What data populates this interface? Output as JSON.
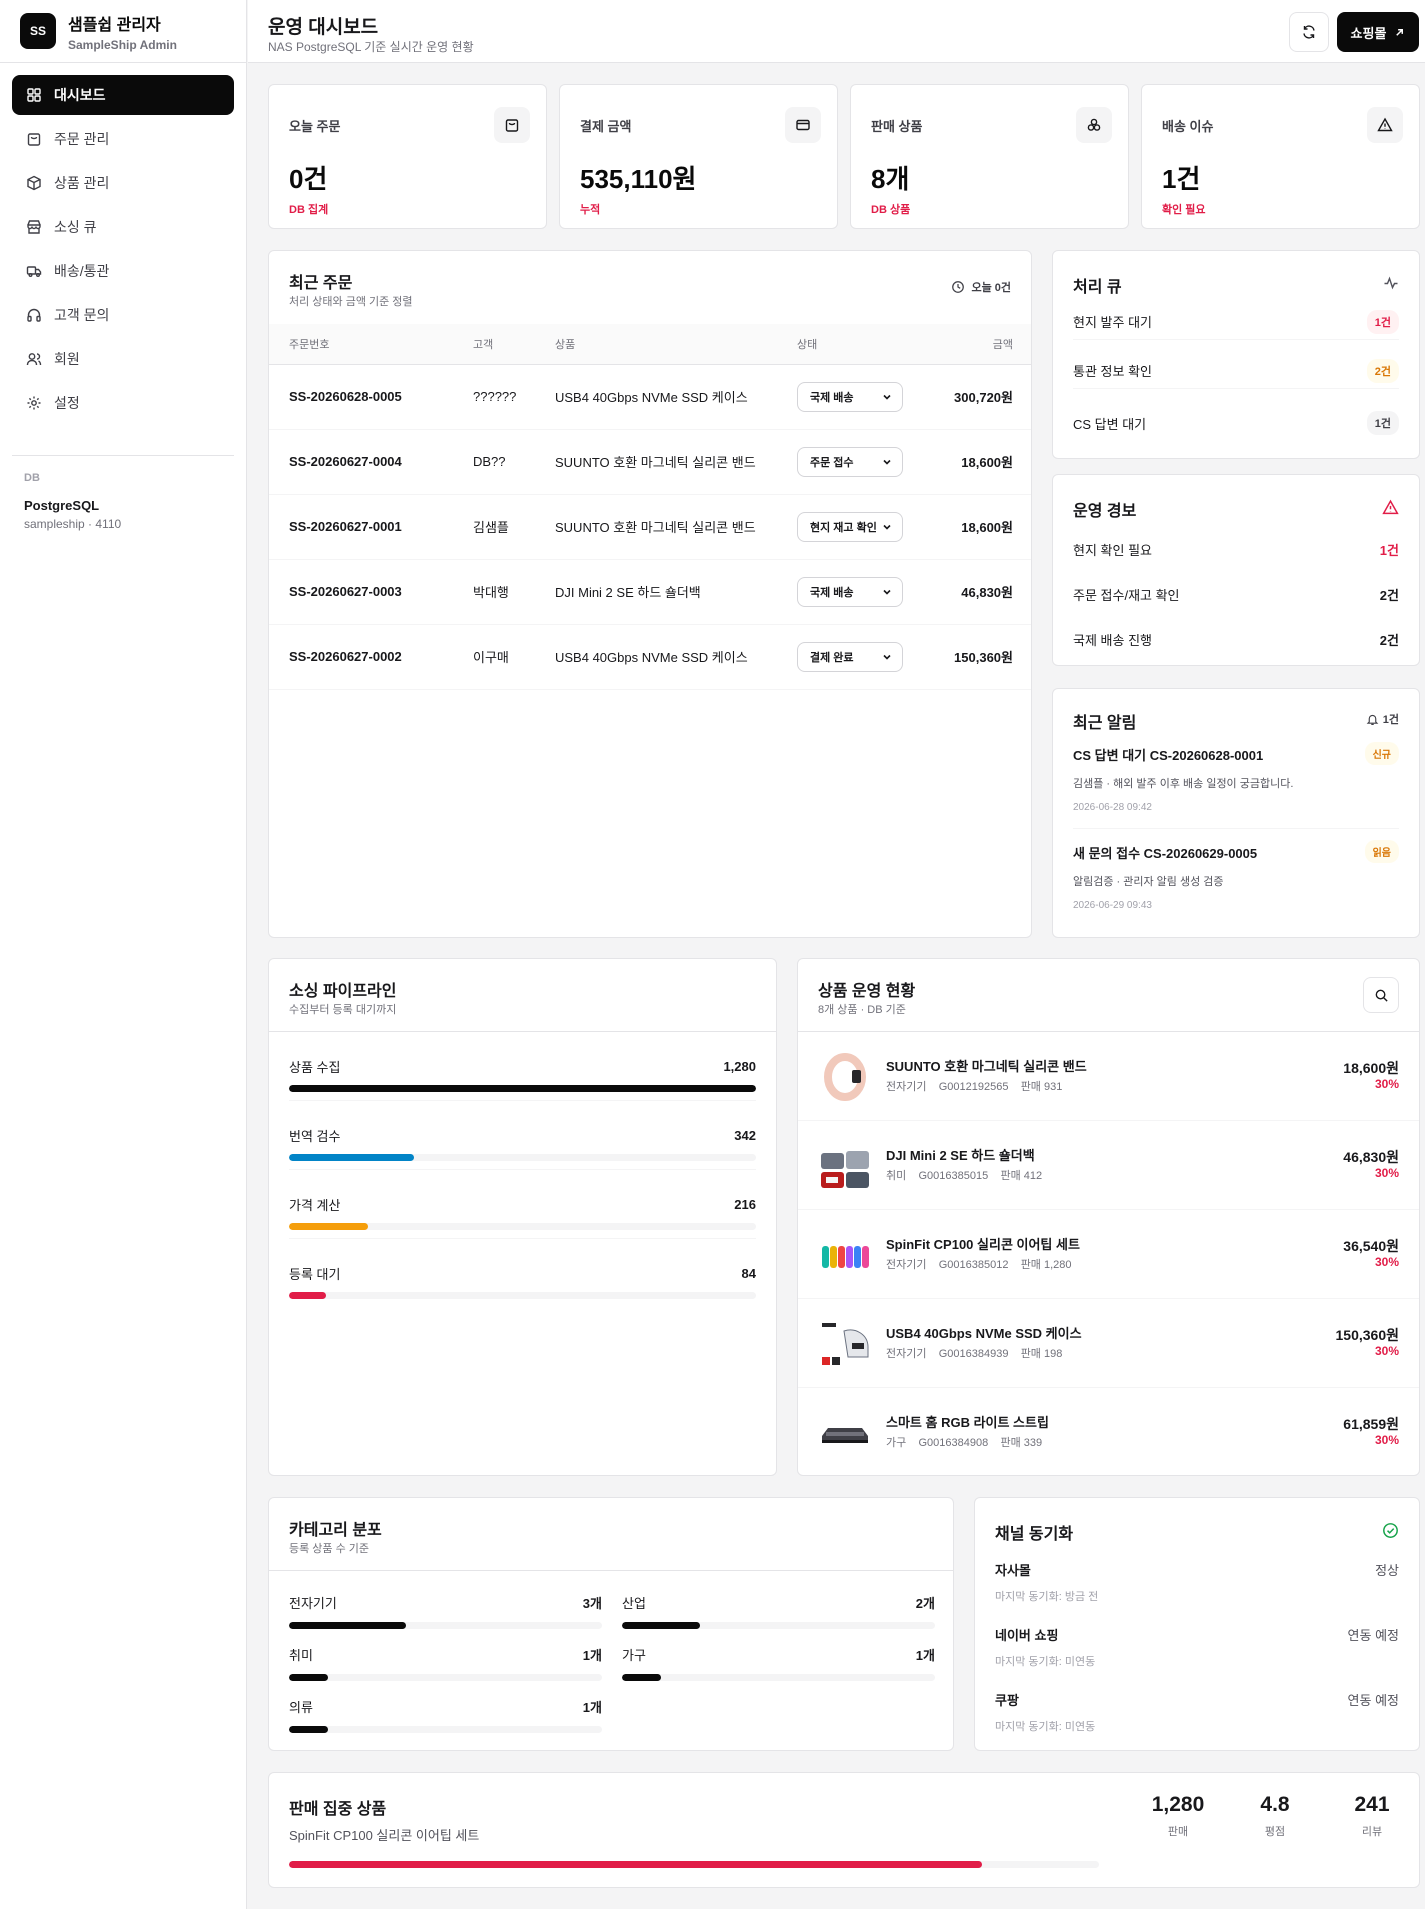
{
  "brand": {
    "logo": "SS",
    "title": "샘플쉽 관리자",
    "subtitle": "SampleShip Admin"
  },
  "nav": [
    {
      "label": "대시보드",
      "icon": "dashboard-icon",
      "active": true
    },
    {
      "label": "주문 관리",
      "icon": "bag-icon"
    },
    {
      "label": "상품 관리",
      "icon": "package-icon"
    },
    {
      "label": "소싱 큐",
      "icon": "store-icon"
    },
    {
      "label": "배송/통관",
      "icon": "truck-icon"
    },
    {
      "label": "고객 문의",
      "icon": "headphones-icon"
    },
    {
      "label": "회원",
      "icon": "users-icon"
    },
    {
      "label": "설정",
      "icon": "gear-icon"
    }
  ],
  "db": {
    "label": "DB",
    "name": "PostgreSQL",
    "sub": "sampleship · 4110"
  },
  "header": {
    "title": "운영 대시보드",
    "subtitle": "NAS PostgreSQL 기준 실시간 운영 현황",
    "shop_label": "쇼핑몰"
  },
  "kpis": [
    {
      "label": "오늘 주문",
      "value": "0건",
      "note": "DB 집계",
      "icon": "bag-icon"
    },
    {
      "label": "결제 금액",
      "value": "535,110원",
      "note": "누적",
      "icon": "credit-card-icon"
    },
    {
      "label": "판매 상품",
      "value": "8개",
      "note": "DB 상품",
      "icon": "boxes-icon"
    },
    {
      "label": "배송 이슈",
      "value": "1건",
      "note": "확인 필요",
      "icon": "alert-triangle-icon"
    }
  ],
  "orders": {
    "title": "최근 주문",
    "subtitle": "처리 상태와 금액 기준 정렬",
    "today": "오늘 0건",
    "columns": [
      "주문번호",
      "고객",
      "상품",
      "상태",
      "금액"
    ],
    "rows": [
      {
        "id": "SS-20260628-0005",
        "customer": "??????",
        "product": "USB4 40Gbps NVMe SSD 케이스",
        "status": "국제 배송",
        "amount": "300,720원"
      },
      {
        "id": "SS-20260627-0004",
        "customer": "DB??",
        "product": "SUUNTO 호환 마그네틱 실리콘 밴드",
        "status": "주문 접수",
        "amount": "18,600원"
      },
      {
        "id": "SS-20260627-0001",
        "customer": "김샘플",
        "product": "SUUNTO 호환 마그네틱 실리콘 밴드",
        "status": "현지 재고 확인",
        "amount": "18,600원"
      },
      {
        "id": "SS-20260627-0003",
        "customer": "박대행",
        "product": "DJI Mini 2 SE 하드 숄더백",
        "status": "국제 배송",
        "amount": "46,830원"
      },
      {
        "id": "SS-20260627-0002",
        "customer": "이구매",
        "product": "USB4 40Gbps NVMe SSD 케이스",
        "status": "결제 완료",
        "amount": "150,360원"
      }
    ]
  },
  "queue": {
    "title": "처리 큐",
    "items": [
      {
        "label": "현지 발주 대기",
        "count": "1건",
        "color": "#e11d48",
        "bg": "#fff1f2"
      },
      {
        "label": "통관 정보 확인",
        "count": "2건",
        "color": "#d97706",
        "bg": "#fffbeb"
      },
      {
        "label": "CS 답변 대기",
        "count": "1건",
        "color": "#3f3f46",
        "bg": "#f4f4f5"
      }
    ]
  },
  "alerts": {
    "title": "운영 경보",
    "items": [
      {
        "label": "현지 확인 필요",
        "count": "1건",
        "color": "#e11d48"
      },
      {
        "label": "주문 접수/재고 확인",
        "count": "2건",
        "color": "#0a0a0a"
      },
      {
        "label": "국제 배송 진행",
        "count": "2건",
        "color": "#0a0a0a"
      }
    ]
  },
  "notices": {
    "title": "최근 알림",
    "count": "1건",
    "items": [
      {
        "title": "CS 답변 대기 CS-20260628-0001",
        "badge": "신규",
        "desc": "김샘플 · 해외 발주 이후 배송 일정이 궁금합니다.",
        "time": "2026-06-28 09:42"
      },
      {
        "title": "새 문의 접수 CS-20260629-0005",
        "badge": "읽음",
        "desc": "알림검증 · 관리자 알림 생성 검증",
        "time": "2026-06-29 09:43"
      }
    ]
  },
  "pipeline": {
    "title": "소싱 파이프라인",
    "subtitle": "수집부터 등록 대기까지",
    "items": [
      {
        "label": "상품 수집",
        "value": "1,280",
        "fraction": 1.0,
        "color": "#0a0a0a"
      },
      {
        "label": "번역 검수",
        "value": "342",
        "fraction": 0.267,
        "color": "#0284c7"
      },
      {
        "label": "가격 계산",
        "value": "216",
        "fraction": 0.169,
        "color": "#f59e0b"
      },
      {
        "label": "등록 대기",
        "value": "84",
        "fraction": 0.08,
        "color": "#e11d48"
      }
    ]
  },
  "products": {
    "title": "상품 운영 현황",
    "subtitle": "8개 상품 · DB 기준",
    "items": [
      {
        "name": "SUUNTO 호환 마그네틱 실리콘 밴드",
        "category": "전자기기",
        "code": "G0012192565",
        "sales": "판매 931",
        "price": "18,600원",
        "pct": "30%",
        "thumb": "watch-band"
      },
      {
        "name": "DJI Mini 2 SE 하드 숄더백",
        "category": "취미",
        "code": "G0016385015",
        "sales": "판매 412",
        "price": "46,830원",
        "pct": "30%",
        "thumb": "drone-bag"
      },
      {
        "name": "SpinFit CP100 실리콘 이어팁 세트",
        "category": "전자기기",
        "code": "G0016385012",
        "sales": "판매 1,280",
        "price": "36,540원",
        "pct": "30%",
        "thumb": "eartips"
      },
      {
        "name": "USB4 40Gbps NVMe SSD 케이스",
        "category": "전자기기",
        "code": "G0016384939",
        "sales": "판매 198",
        "price": "150,360원",
        "pct": "30%",
        "thumb": "ssd-case"
      },
      {
        "name": "스마트 홈 RGB 라이트 스트립",
        "category": "가구",
        "code": "G0016384908",
        "sales": "판매 339",
        "price": "61,859원",
        "pct": "30%",
        "thumb": "light-strip"
      }
    ]
  },
  "categories": {
    "title": "카테고리 분포",
    "subtitle": "등록 상품 수 기준",
    "items": [
      {
        "label": "전자기기",
        "value": "3개",
        "fraction": 0.375
      },
      {
        "label": "산업",
        "value": "2개",
        "fraction": 0.25
      },
      {
        "label": "취미",
        "value": "1개",
        "fraction": 0.125
      },
      {
        "label": "가구",
        "value": "1개",
        "fraction": 0.125
      },
      {
        "label": "의류",
        "value": "1개",
        "fraction": 0.125
      }
    ]
  },
  "channels": {
    "title": "채널 동기화",
    "items": [
      {
        "name": "자사몰",
        "sync": "마지막 동기화: 방금 전",
        "status": "정상"
      },
      {
        "name": "네이버 쇼핑",
        "sync": "마지막 동기화: 미연동",
        "status": "연동 예정"
      },
      {
        "name": "쿠팡",
        "sync": "마지막 동기화: 미연동",
        "status": "연동 예정"
      }
    ]
  },
  "focus": {
    "title": "판매 집중 상품",
    "product": "SpinFit CP100 실리콘 이어팁 세트",
    "progress": 0.855,
    "stats": [
      {
        "value": "1,280",
        "label": "판매"
      },
      {
        "value": "4.8",
        "label": "평점"
      },
      {
        "value": "241",
        "label": "리뷰"
      }
    ]
  },
  "colors": {
    "accent": "#e11d48",
    "dark": "#0a0a0a",
    "border": "#e4e4e7",
    "ok": "#16a34a"
  }
}
